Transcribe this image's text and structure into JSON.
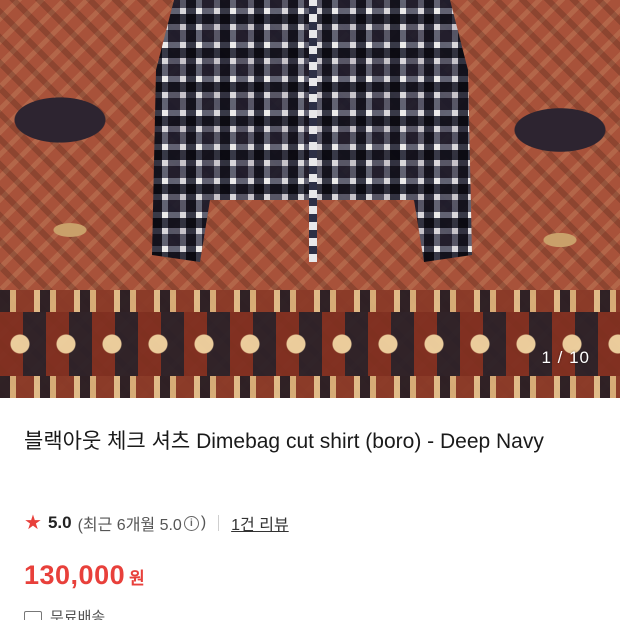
{
  "gallery": {
    "counter": "1 / 10"
  },
  "product": {
    "title": "블랙아웃 체크 셔츠 Dimebag cut shirt (boro) - Deep Navy"
  },
  "rating": {
    "score": "5.0",
    "recent_text": "(최근 6개월 5.0",
    "info_symbol": "i",
    "close_paren": ")",
    "review_link": "1건 리뷰",
    "star_color": "#e8403b"
  },
  "price": {
    "amount": "130,000",
    "currency": "원",
    "color": "#e8403b"
  },
  "shipping": {
    "label": "무료배송"
  }
}
